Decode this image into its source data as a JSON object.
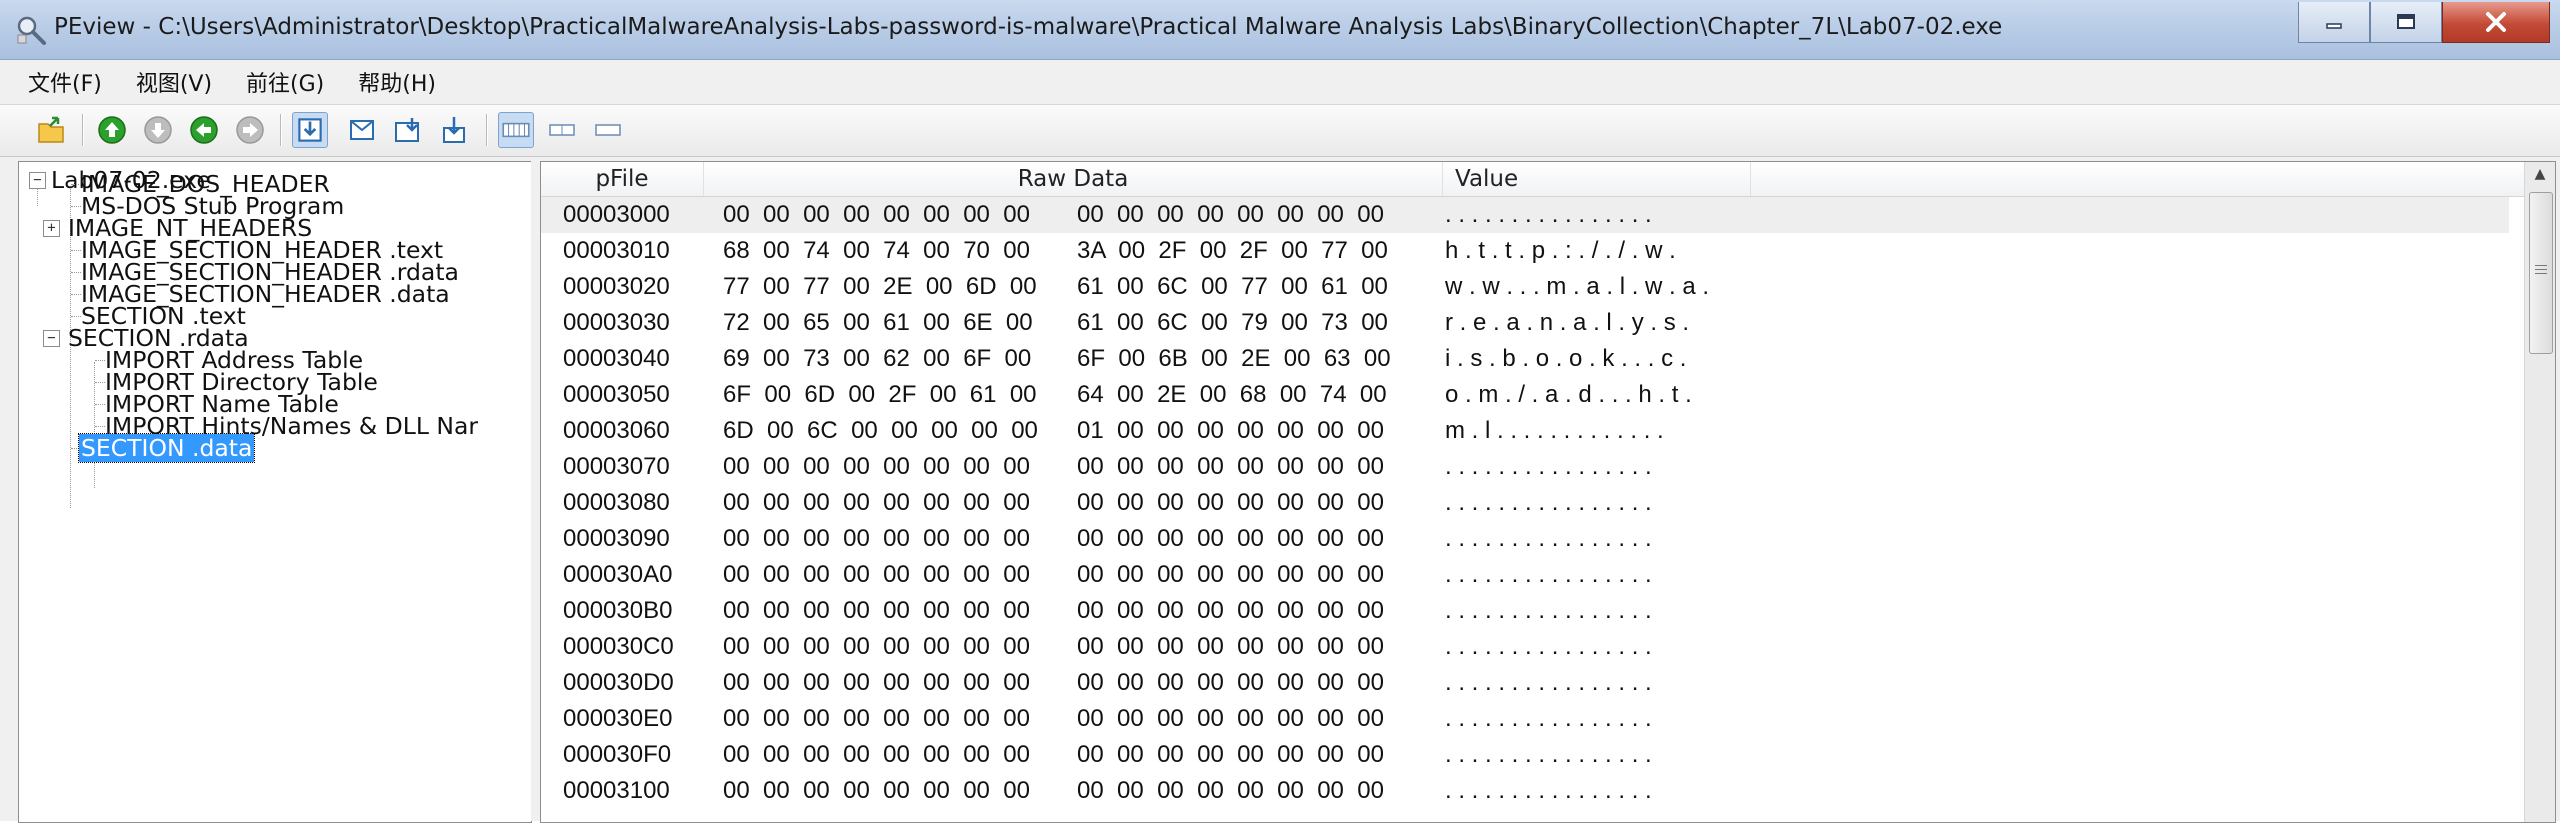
{
  "window": {
    "title": "PEview - C:\\Users\\Administrator\\Desktop\\PracticalMalwareAnalysis-Labs-password-is-malware\\Practical Malware Analysis Labs\\BinaryCollection\\Chapter_7L\\Lab07-02.exe",
    "app_icon": "magnifier-icon",
    "minimize_icon": "minimize-icon",
    "maximize_icon": "maximize-icon",
    "close_icon": "close-icon"
  },
  "menu": {
    "file": "文件(F)",
    "view": "视图(V)",
    "go": "前往(G)",
    "help": "帮助(H)"
  },
  "toolbar": {
    "icons": [
      "open-file-icon",
      "go-up-icon",
      "go-down-icon",
      "go-back-icon",
      "go-forward-icon",
      "view-mode-1-icon",
      "view-mode-2-icon",
      "view-mode-3-icon",
      "view-mode-4-icon",
      "layout-byte-icon",
      "layout-word-icon",
      "layout-dword-icon"
    ]
  },
  "tree": {
    "root": "Lab07-02.exe",
    "items": [
      "IMAGE_DOS_HEADER",
      "MS-DOS Stub Program",
      "IMAGE_NT_HEADERS",
      "IMAGE_SECTION_HEADER .text",
      "IMAGE_SECTION_HEADER .rdata",
      "IMAGE_SECTION_HEADER .data",
      "SECTION .text",
      "SECTION .rdata",
      "IMPORT Address Table",
      "IMPORT Directory Table",
      "IMPORT Name Table",
      "IMPORT Hints/Names & DLL Nar",
      "SECTION .data"
    ],
    "selected": "SECTION .data"
  },
  "table": {
    "headers": {
      "pfile": "pFile",
      "raw": "Raw Data",
      "value": "Value"
    },
    "rows": [
      {
        "pfile": "00003000",
        "raw1": "00  00  00  00  00  00  00  00",
        "raw2": "00  00  00  00  00  00  00  00",
        "value": ". . . . . . . . . . . . . . . ."
      },
      {
        "pfile": "00003010",
        "raw1": "68  00  74  00  74  00  70  00",
        "raw2": "3A  00  2F  00  2F  00  77  00",
        "value": "h . t . t . p . : . / . / . w ."
      },
      {
        "pfile": "00003020",
        "raw1": "77  00  77  00  2E  00  6D  00",
        "raw2": "61  00  6C  00  77  00  61  00",
        "value": "w . w . . . m . a . l . w . a ."
      },
      {
        "pfile": "00003030",
        "raw1": "72  00  65  00  61  00  6E  00",
        "raw2": "61  00  6C  00  79  00  73  00",
        "value": "r . e . a . n . a . l . y . s ."
      },
      {
        "pfile": "00003040",
        "raw1": "69  00  73  00  62  00  6F  00",
        "raw2": "6F  00  6B  00  2E  00  63  00",
        "value": "i . s . b . o . o . k . . . c ."
      },
      {
        "pfile": "00003050",
        "raw1": "6F  00  6D  00  2F  00  61  00",
        "raw2": "64  00  2E  00  68  00  74  00",
        "value": "o . m . / . a . d . . . h . t ."
      },
      {
        "pfile": "00003060",
        "raw1": "6D  00  6C  00  00  00  00  00",
        "raw2": "01  00  00  00  00  00  00  00",
        "value": "m . l . . . . . . . . . . . . ."
      },
      {
        "pfile": "00003070",
        "raw1": "00  00  00  00  00  00  00  00",
        "raw2": "00  00  00  00  00  00  00  00",
        "value": ". . . . . . . . . . . . . . . ."
      },
      {
        "pfile": "00003080",
        "raw1": "00  00  00  00  00  00  00  00",
        "raw2": "00  00  00  00  00  00  00  00",
        "value": ". . . . . . . . . . . . . . . ."
      },
      {
        "pfile": "00003090",
        "raw1": "00  00  00  00  00  00  00  00",
        "raw2": "00  00  00  00  00  00  00  00",
        "value": ". . . . . . . . . . . . . . . ."
      },
      {
        "pfile": "000030A0",
        "raw1": "00  00  00  00  00  00  00  00",
        "raw2": "00  00  00  00  00  00  00  00",
        "value": ". . . . . . . . . . . . . . . ."
      },
      {
        "pfile": "000030B0",
        "raw1": "00  00  00  00  00  00  00  00",
        "raw2": "00  00  00  00  00  00  00  00",
        "value": ". . . . . . . . . . . . . . . ."
      },
      {
        "pfile": "000030C0",
        "raw1": "00  00  00  00  00  00  00  00",
        "raw2": "00  00  00  00  00  00  00  00",
        "value": ". . . . . . . . . . . . . . . ."
      },
      {
        "pfile": "000030D0",
        "raw1": "00  00  00  00  00  00  00  00",
        "raw2": "00  00  00  00  00  00  00  00",
        "value": ". . . . . . . . . . . . . . . ."
      },
      {
        "pfile": "000030E0",
        "raw1": "00  00  00  00  00  00  00  00",
        "raw2": "00  00  00  00  00  00  00  00",
        "value": ". . . . . . . . . . . . . . . ."
      },
      {
        "pfile": "000030F0",
        "raw1": "00  00  00  00  00  00  00  00",
        "raw2": "00  00  00  00  00  00  00  00",
        "value": ". . . . . . . . . . . . . . . ."
      },
      {
        "pfile": "00003100",
        "raw1": "00  00  00  00  00  00  00  00",
        "raw2": "00  00  00  00  00  00  00  00",
        "value": ". . . . . . . . . . . . . . . ."
      }
    ]
  },
  "colors": {
    "selection": "#3399ff",
    "titlebar": "#b7cbe6",
    "close_button": "#c44a36"
  }
}
